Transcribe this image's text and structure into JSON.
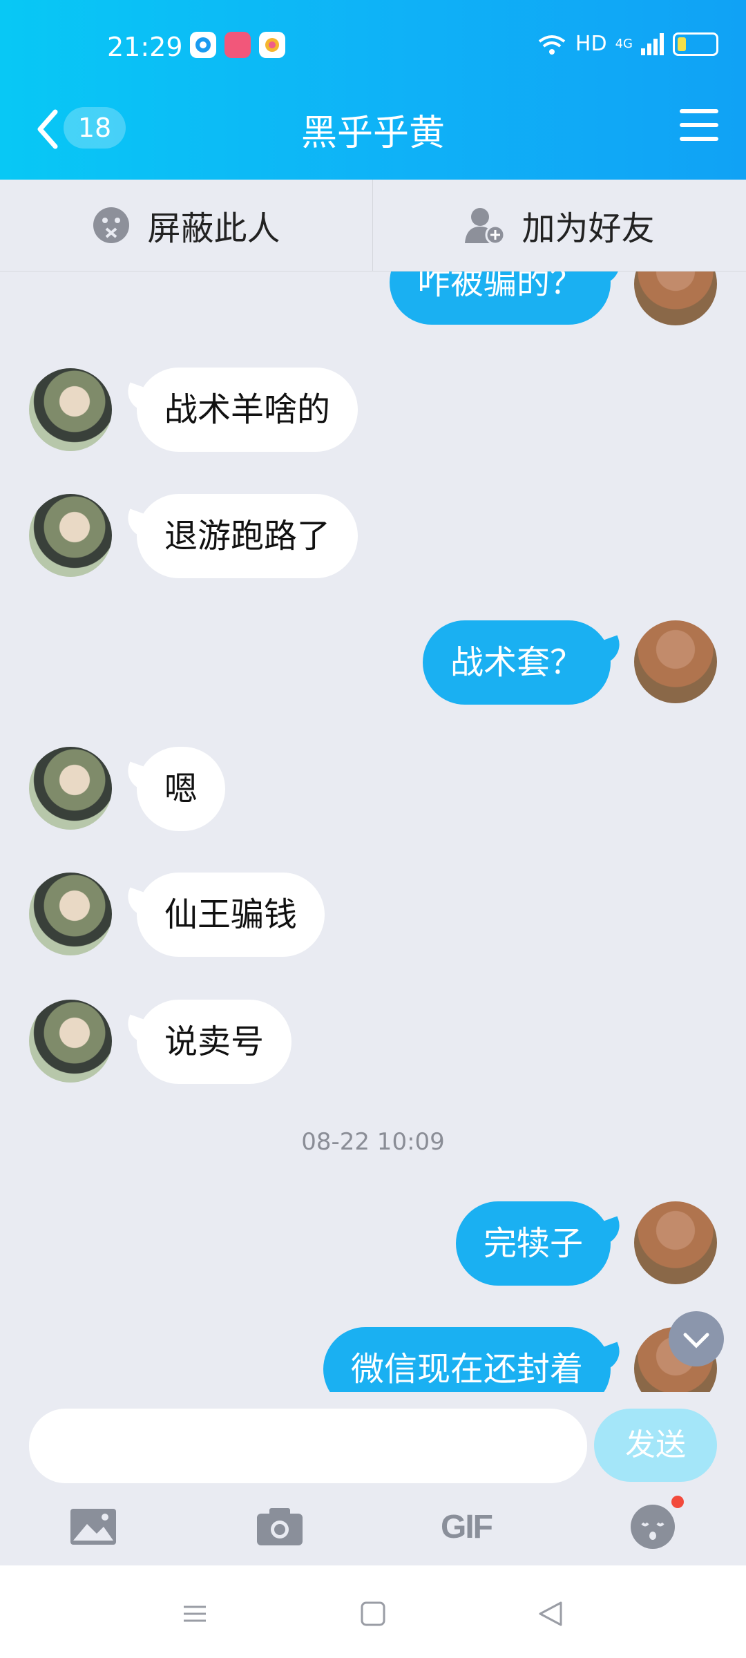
{
  "status": {
    "time": "21:29",
    "net": "HD",
    "signal": "4G"
  },
  "header": {
    "unread_count": "18",
    "title": "黑乎乎黄"
  },
  "actions": {
    "block_label": "屏蔽此人",
    "add_friend_label": "加为好友"
  },
  "messages": [
    {
      "side": "right",
      "text": "咋被骗的？"
    },
    {
      "side": "left",
      "text": "战术羊啥的"
    },
    {
      "side": "left",
      "text": "退游跑路了"
    },
    {
      "side": "right",
      "text": "战术套？"
    },
    {
      "side": "left",
      "text": "嗯"
    },
    {
      "side": "left",
      "text": "仙王骗钱"
    },
    {
      "side": "left",
      "text": "说卖号"
    },
    {
      "side": "right",
      "text": "完犊子"
    },
    {
      "side": "right",
      "text": "微信现在还封着"
    }
  ],
  "timestamp": "08-22 10:09",
  "input": {
    "value": "",
    "send_label": "发送"
  },
  "toolbar": {
    "gif_label": "GIF",
    "icons": [
      "image-icon",
      "camera-icon",
      "gif-icon",
      "emoji-icon"
    ]
  },
  "colors": {
    "accent": "#10a2f5",
    "bubble_self": "#1ab0f2",
    "send_disabled": "#a4e6f9",
    "badge_red": "#f24a3c"
  }
}
